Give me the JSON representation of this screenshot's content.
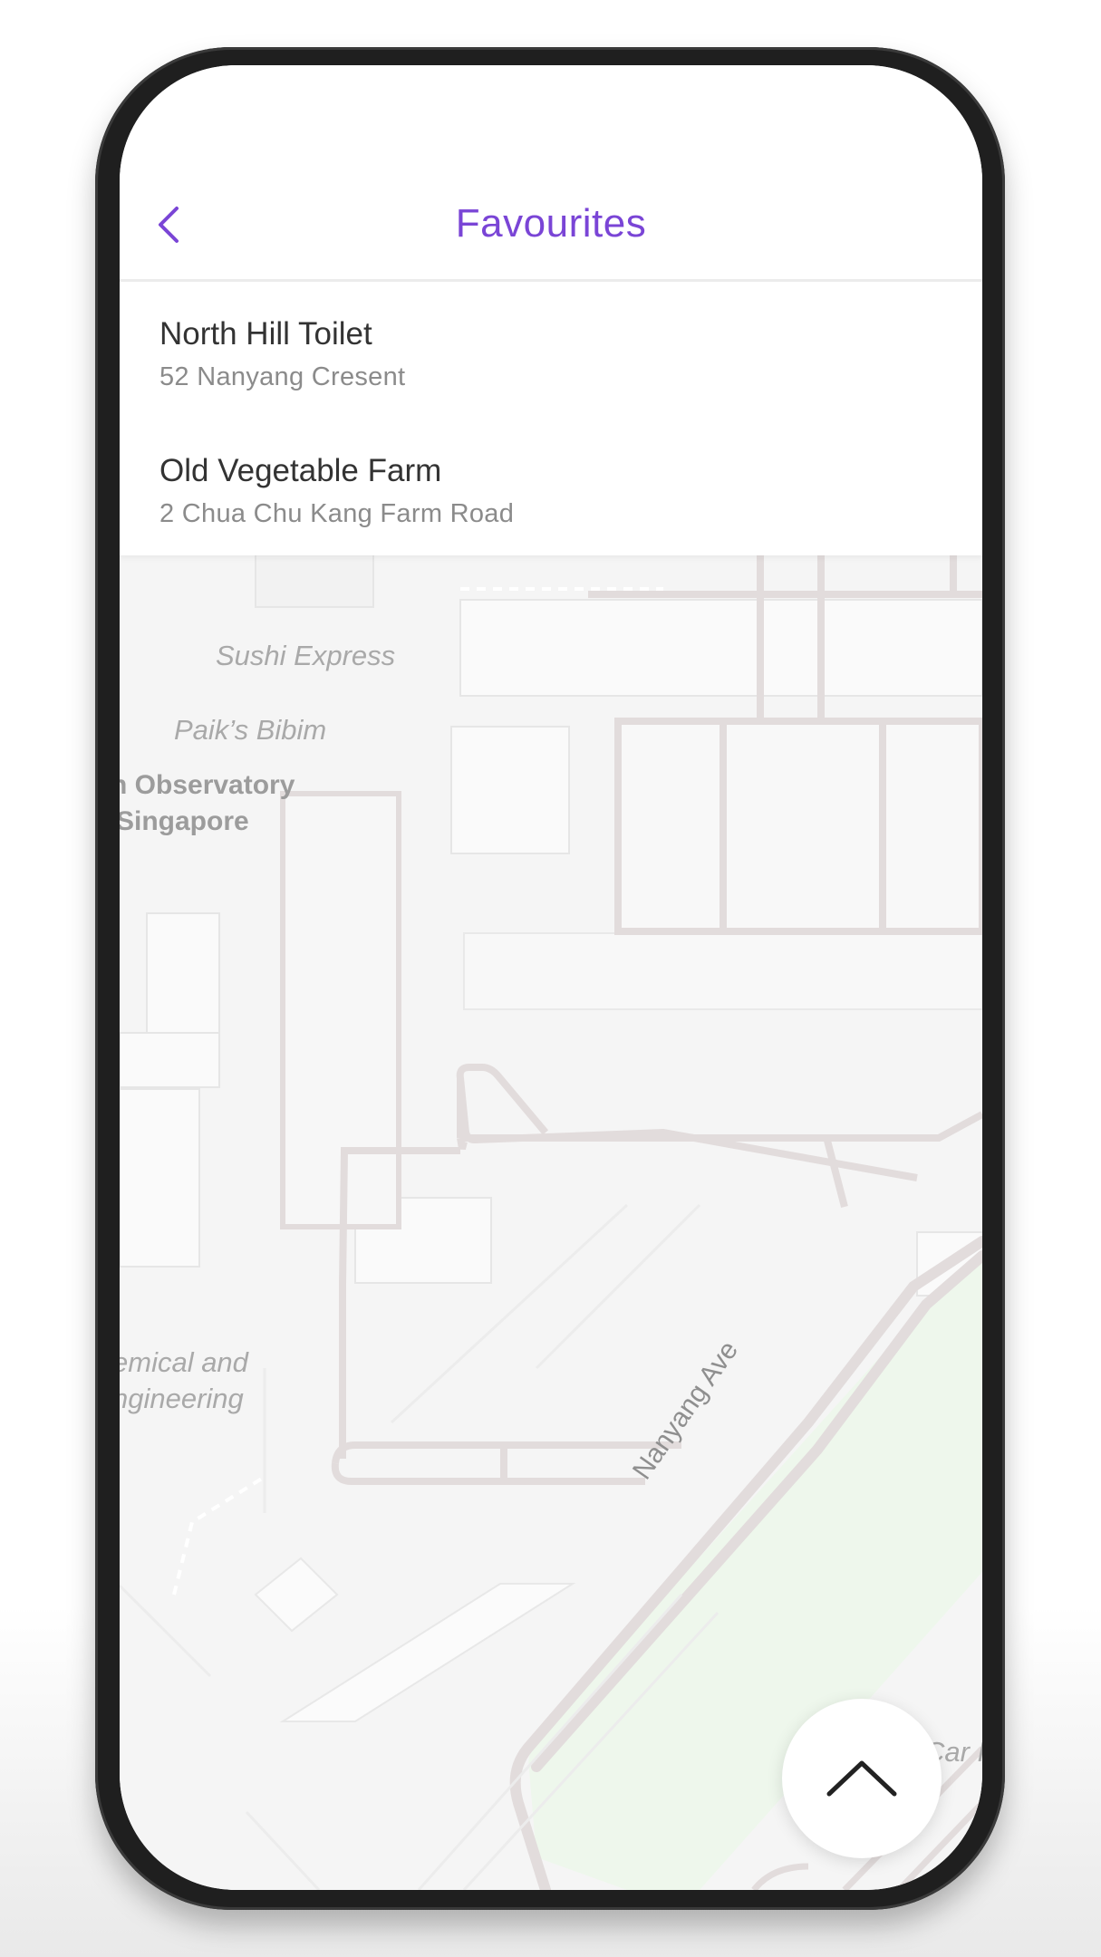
{
  "header": {
    "title": "Favourites",
    "back_icon": "chevron-left-icon",
    "accent_color": "#7a45d6"
  },
  "favourites": [
    {
      "name": "North Hill Toilet",
      "address": "52 Nanyang Cresent"
    },
    {
      "name": "Old Vegetable Farm",
      "address": "2 Chua Chu Kang Farm Road"
    }
  ],
  "map": {
    "labels": {
      "sushi": "Sushi Express",
      "paik": "Paik’s Bibim",
      "observatory_line1": "n Observatory",
      "observatory_line2": "Singapore",
      "chemical_line1": "emical and",
      "chemical_line2": "ngineering",
      "car": "Car P"
    },
    "road_label": "Nanyang Ave",
    "park_color": "#eef7ec",
    "road_color": "#e2dcdc"
  },
  "fab": {
    "icon": "chevron-up-icon"
  }
}
